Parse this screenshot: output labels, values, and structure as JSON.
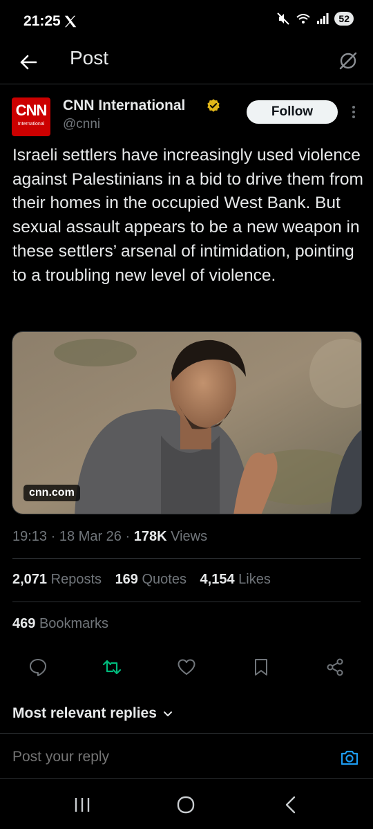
{
  "status_bar": {
    "time": "21:25",
    "battery": "52",
    "icons": [
      "x-logo-icon",
      "mute-icon",
      "wifi-icon",
      "signal-icon",
      "battery-icon"
    ]
  },
  "header": {
    "title": "Post",
    "back_icon": "arrow-left-icon",
    "right_icon": "grok-icon"
  },
  "post": {
    "avatar": {
      "logo_text": "CNN",
      "logo_subtext": "International"
    },
    "display_name": "CNN International",
    "handle": "@cnni",
    "follow_label": "Follow",
    "text": "Israeli settlers have increasingly used violence against Palestinians in a bid to drive them from their homes in the occupied West Bank. But sexual assault appears to be a new weapon in these settlers’ arsenal of intimidation, pointing to a troubling new level of violence.",
    "media": {
      "domain": "cnn.com"
    },
    "time": "19:13",
    "date": "18 Mar 26",
    "views_count": "178K",
    "views_label": "Views",
    "separator": "·"
  },
  "stats": {
    "reposts": {
      "count": "2,071",
      "label": "Reposts"
    },
    "quotes": {
      "count": "169",
      "label": "Quotes"
    },
    "likes": {
      "count": "4,154",
      "label": "Likes"
    },
    "bookmarks": {
      "count": "469",
      "label": "Bookmarks"
    }
  },
  "actions": [
    "reply-icon",
    "repost-icon",
    "like-icon",
    "bookmark-icon",
    "share-icon"
  ],
  "colors": {
    "repost_active": "#00ba7c",
    "link_blue": "#1d9bf0",
    "muted": "#71767b",
    "divider": "#2f3336",
    "cnn_red": "#cc0000"
  },
  "replies": {
    "filter_label": "Most relevant replies",
    "input_placeholder": "Post your reply"
  },
  "nav": [
    "recents-icon",
    "home-icon",
    "back-icon"
  ]
}
